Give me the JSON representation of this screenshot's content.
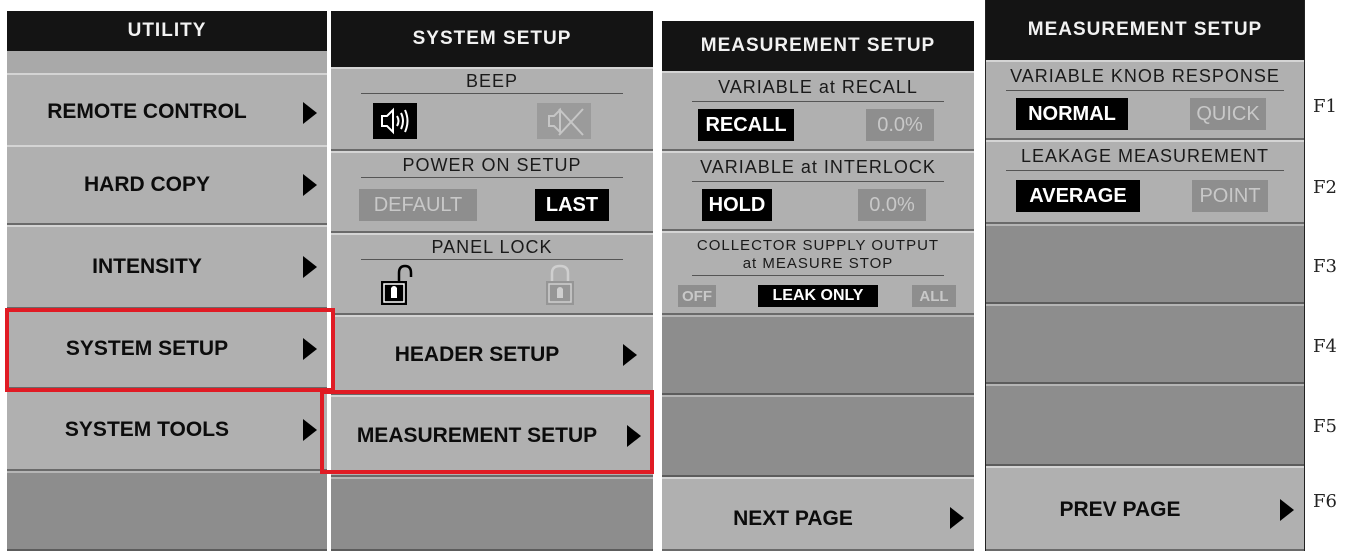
{
  "utility": {
    "title": "UTILITY",
    "items": [
      {
        "label": "REMOTE CONTROL"
      },
      {
        "label": "HARD COPY"
      },
      {
        "label": "INTENSITY"
      },
      {
        "label": "SYSTEM SETUP"
      },
      {
        "label": "SYSTEM TOOLS"
      }
    ]
  },
  "system_setup": {
    "title": "SYSTEM SETUP",
    "beep": {
      "title": "BEEP",
      "on_icon": "speaker-on-icon",
      "off_icon": "speaker-mute-icon"
    },
    "power_on_setup": {
      "title": "POWER ON SETUP",
      "opt_default": "DEFAULT",
      "opt_last": "LAST",
      "selected": "LAST"
    },
    "panel_lock": {
      "title": "PANEL LOCK",
      "unlocked_icon": "padlock-open-icon",
      "locked_icon": "padlock-closed-icon"
    },
    "header_setup": "HEADER SETUP",
    "measurement_setup": "MEASUREMENT SETUP"
  },
  "measurement_setup_p1": {
    "title": "MEASUREMENT SETUP",
    "recall": {
      "title": "VARIABLE at RECALL",
      "opt_a": "RECALL",
      "opt_b": "0.0%",
      "selected": "RECALL"
    },
    "interlock": {
      "title": "VARIABLE at INTERLOCK",
      "opt_a": "HOLD",
      "opt_b": "0.0%",
      "selected": "HOLD"
    },
    "collector": {
      "title_1": "COLLECTOR SUPPLY OUTPUT",
      "title_2": "at MEASURE STOP",
      "opt_off": "OFF",
      "opt_leak": "LEAK ONLY",
      "opt_all": "ALL",
      "selected": "LEAK ONLY"
    },
    "next_page": "NEXT PAGE"
  },
  "measurement_setup_p2": {
    "title": "MEASUREMENT SETUP",
    "knob": {
      "title": "VARIABLE KNOB RESPONSE",
      "opt_a": "NORMAL",
      "opt_b": "QUICK",
      "selected": "NORMAL"
    },
    "leakage": {
      "title": "LEAKAGE MEASUREMENT",
      "opt_a": "AVERAGE",
      "opt_b": "POINT",
      "selected": "AVERAGE"
    },
    "prev_page": "PREV PAGE"
  },
  "function_keys": [
    "F1",
    "F2",
    "F3",
    "F4",
    "F5",
    "F6"
  ],
  "colors": {
    "highlight": "#e01b24",
    "header": "#141414",
    "panel": "#a9a9a9"
  }
}
